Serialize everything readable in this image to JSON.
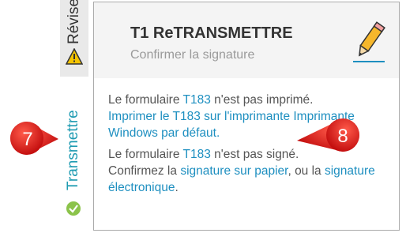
{
  "tabs": {
    "revise": {
      "label": "Révise"
    },
    "transmettre": {
      "label": "Transmettre"
    }
  },
  "card": {
    "title": "T1 ReTRANSMETTRE",
    "subtitle": "Confirmer la signature",
    "body": {
      "p1_pre": "Le formulaire ",
      "p1_link_form": "T183",
      "p1_post": " n'est pas imprimé.",
      "p1_action_link": "Imprimer le T183 sur l'imprimante Imprimante Windows par défaut.",
      "p2_pre": "Le formulaire ",
      "p2_link_form": "T183",
      "p2_post": " n'est pas signé.",
      "p3_pre": "Confirmez la ",
      "p3_link_paper": "signature sur papier",
      "p3_mid": ", ou la ",
      "p3_link_electronic": "signature électronique",
      "p3_post": "."
    }
  },
  "callouts": {
    "seven": "7",
    "eight": "8"
  },
  "colors": {
    "accent": "#1e8fc0",
    "callout_red": "#e02020",
    "warning_yellow": "#f5c400"
  },
  "icons": {
    "revise": "warning-icon",
    "transmettre": "checkmark-circle-icon",
    "sign": "pencil-icon"
  }
}
